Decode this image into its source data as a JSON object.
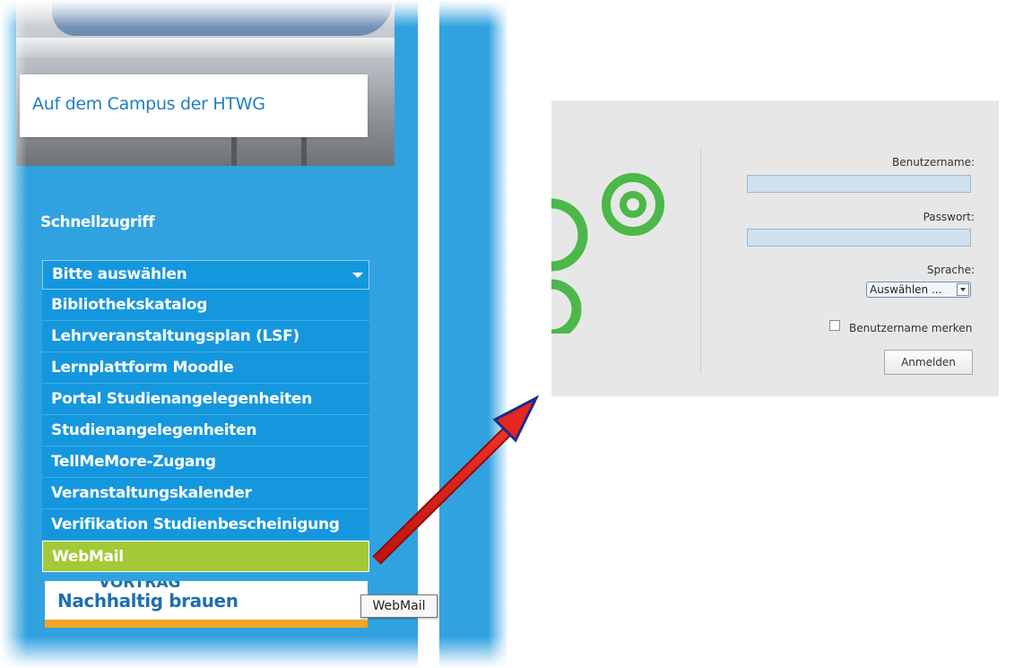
{
  "campus": {
    "caption": "Auf dem Campus der HTWG"
  },
  "quickaccess": {
    "title": "Schnellzugriff",
    "select_placeholder": "Bitte auswählen",
    "options": [
      "Bibliothekskatalog",
      "Lehrveranstaltungsplan (LSF)",
      "Lernplattform Moodle",
      "Portal Studienangelegenheiten",
      "Studienangelegenheiten",
      "TellMeMore-Zugang",
      "Veranstaltungskalender",
      "Verifikation Studienbescheinigung",
      "WebMail"
    ],
    "highlighted_option": "WebMail"
  },
  "teaser": {
    "cut_text": "VORTRAG",
    "headline": "Nachhaltig brauen"
  },
  "tooltip": {
    "text": "WebMail"
  },
  "login": {
    "username_label": "Benutzername:",
    "password_label": "Passwort:",
    "language_label": "Sprache:",
    "language_value": "Auswählen ...",
    "remember_label": "Benutzername merken",
    "submit_label": "Anmelden"
  },
  "colors": {
    "htwg_blue": "#31a2e0",
    "dropdown_blue": "#1597de",
    "highlight_green": "#a3c936",
    "logo_green": "#4cb849",
    "arrow_red": "#e8251f"
  },
  "icons": {
    "dropdown_arrow": "chevron-down-icon",
    "logo": "webmail-logo-icon",
    "pointer_arrow": "red-pointer-arrow"
  }
}
